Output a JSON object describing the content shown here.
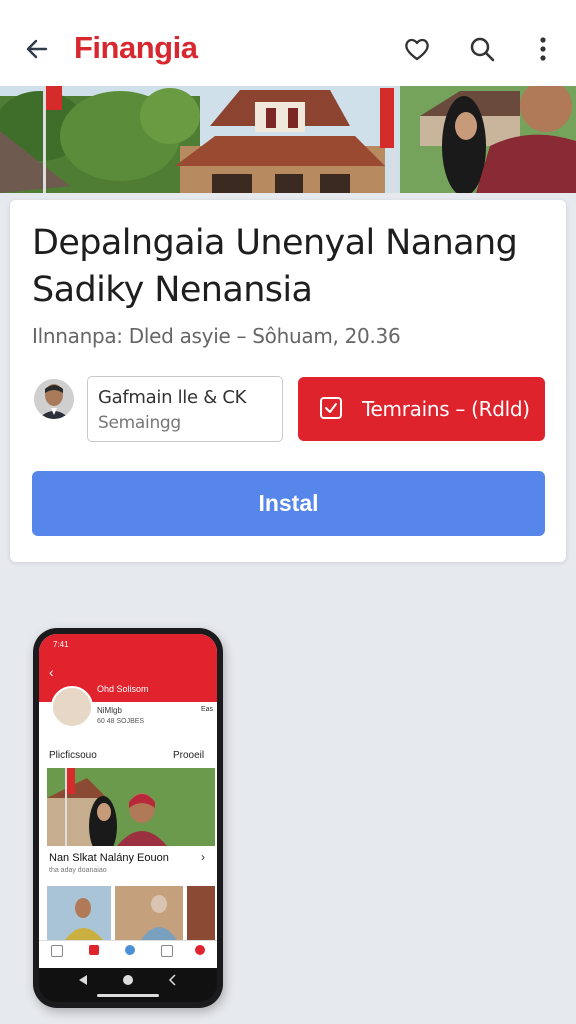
{
  "appbar": {
    "title": "Finangia",
    "icons": [
      "back-arrow-icon",
      "heart-icon",
      "search-icon",
      "more-vert-icon"
    ],
    "brand_color": "#d7282f"
  },
  "article": {
    "headline": "Depalngaia Unenyal  Nanang Sadiky Nenansia",
    "meta": "Ilnnanpa: Dled asyie – Sôhuam, 20.36"
  },
  "author": {
    "name": "Gafmain  lle & CK",
    "subtitle": "Semaingg"
  },
  "actions": {
    "red_button_label": "Temrains – (Rdld)",
    "install_label": "Instal",
    "red_color": "#df232c",
    "blue_color": "#5686ea"
  },
  "phone_preview": {
    "time": "7:41",
    "profile_name": "Ohd Solisom",
    "line1": "NiMlgb",
    "line2": "60 48 SOJBES",
    "right_tag": "Eas",
    "tab_left": "Plicficsouo",
    "tab_right": "Prooeil",
    "caption": "Nan Slkat Nalány Eouon",
    "caption_sub": "tha aday doanaiao"
  }
}
